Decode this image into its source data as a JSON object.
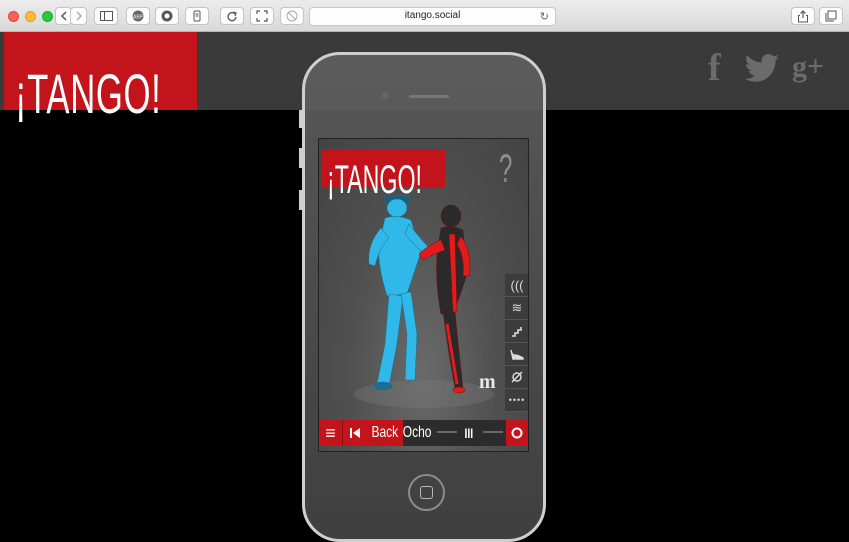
{
  "browser": {
    "url": "itango.social",
    "icons": [
      "sidebar-icon",
      "abp-icon",
      "ghostery-icon",
      "extension-icon",
      "refresh-ext-icon",
      "fullscreen-icon",
      "block-icon",
      "share-icon",
      "tabs-icon"
    ]
  },
  "site": {
    "logo": "¡TANGO!",
    "social": [
      "f",
      "g+"
    ]
  },
  "app": {
    "logo": "¡TANGO!",
    "help": "?",
    "mark": "m",
    "controls": {
      "menu": "≡",
      "back_label": "Back",
      "move_label": "Ocho",
      "pause": "III"
    },
    "colors": {
      "brand_red": "#c4141b",
      "dancer_lead": "#2fb8e8",
      "dancer_follow": "#e21b1b"
    }
  }
}
